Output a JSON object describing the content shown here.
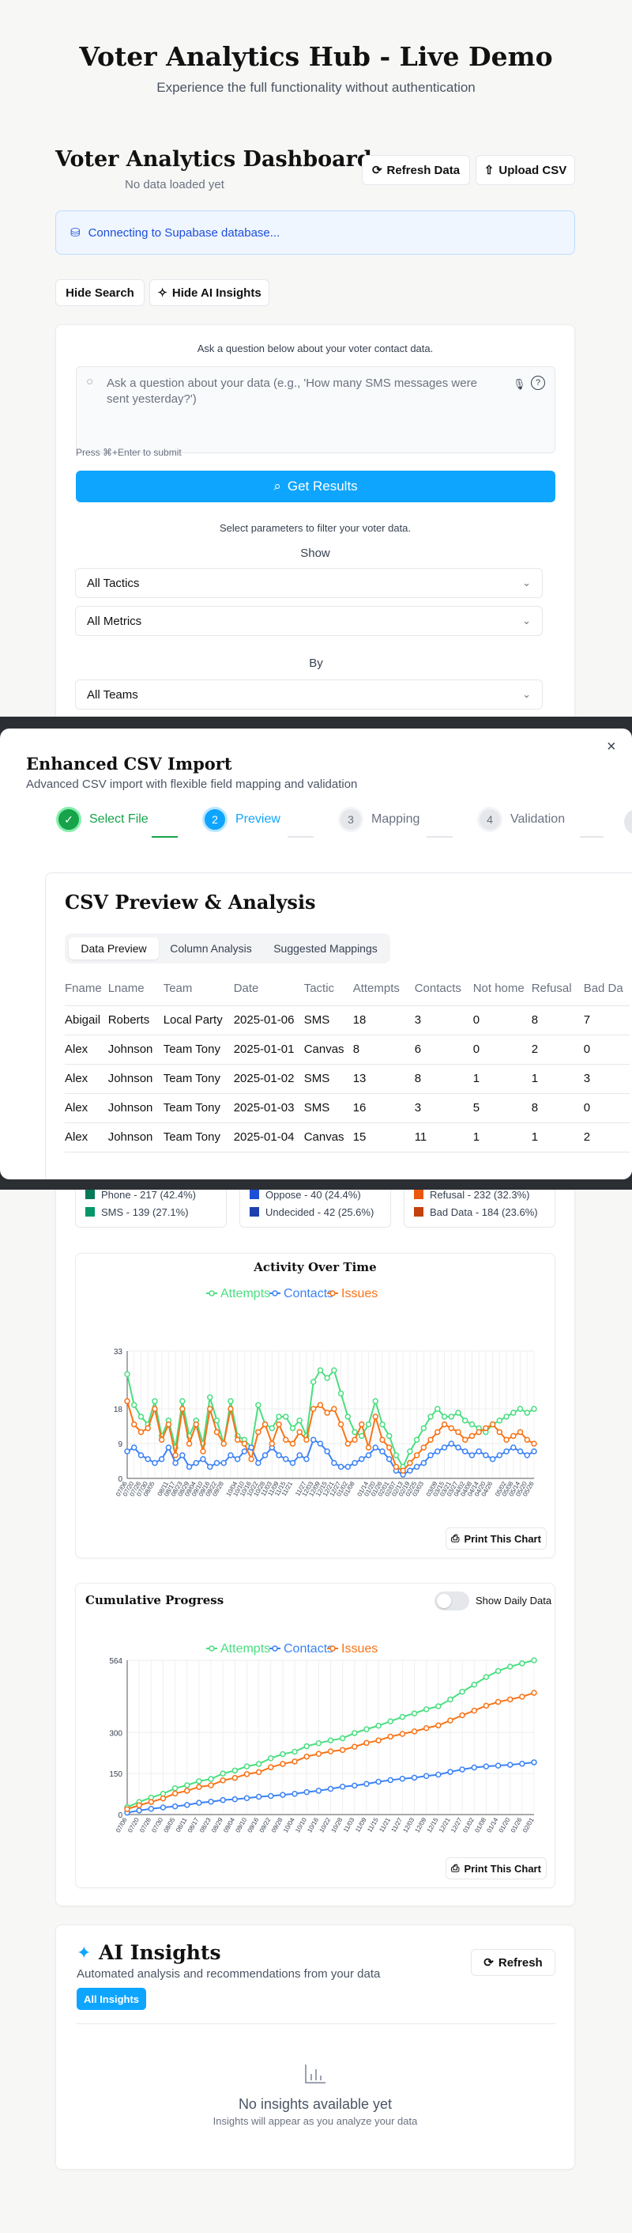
{
  "hero": {
    "title": "Voter Analytics Hub - Live Demo",
    "subtitle": "Experience the full functionality without authentication"
  },
  "dashboard": {
    "title": "Voter Analytics Dashboard",
    "status": "No data loaded yet",
    "refresh_label": "Refresh Data",
    "upload_label": "Upload CSV",
    "db_notice": "Connecting to Supabase database..."
  },
  "toggles": {
    "hide_search": "Hide Search",
    "hide_ai": "Hide AI Insights"
  },
  "query": {
    "intro": "Ask a question below about your voter contact data.",
    "placeholder": "Ask a question about your data (e.g., 'How many SMS messages were sent yesterday?')",
    "hint": "Press ⌘+Enter to submit",
    "submit_label": "Get Results",
    "params_intro": "Select parameters to filter your voter data.",
    "show_label": "Show",
    "tactic_value": "All Tactics",
    "metric_value": "All Metrics",
    "by_label": "By",
    "team_value": "All Teams"
  },
  "modal": {
    "title": "Enhanced CSV Import",
    "subtitle": "Advanced CSV import with flexible field mapping and validation",
    "close": "×",
    "steps": [
      {
        "num": "✓",
        "label": "Select File"
      },
      {
        "num": "2",
        "label": "Preview"
      },
      {
        "num": "3",
        "label": "Mapping"
      },
      {
        "num": "4",
        "label": "Validation"
      }
    ],
    "preview_title": "CSV Preview & Analysis",
    "tabs": [
      "Data Preview",
      "Column Analysis",
      "Suggested Mappings"
    ],
    "columns": [
      "Fname",
      "Lname",
      "Team",
      "Date",
      "Tactic",
      "Attempts",
      "Contacts",
      "Not home",
      "Refusal",
      "Bad Da"
    ],
    "rows": [
      [
        "Abigail",
        "Roberts",
        "Local Party",
        "2025-01-06",
        "SMS",
        "18",
        "3",
        "0",
        "8",
        "7"
      ],
      [
        "Alex",
        "Johnson",
        "Team Tony",
        "2025-01-01",
        "Canvas",
        "8",
        "6",
        "0",
        "2",
        "0"
      ],
      [
        "Alex",
        "Johnson",
        "Team Tony",
        "2025-01-02",
        "SMS",
        "13",
        "8",
        "1",
        "1",
        "3"
      ],
      [
        "Alex",
        "Johnson",
        "Team Tony",
        "2025-01-03",
        "SMS",
        "16",
        "3",
        "5",
        "8",
        "0"
      ],
      [
        "Alex",
        "Johnson",
        "Team Tony",
        "2025-01-04",
        "Canvas",
        "15",
        "11",
        "1",
        "1",
        "2"
      ]
    ]
  },
  "legends": {
    "tactics": [
      {
        "label": "Phone - 217 (42.4%)",
        "color": "#047857"
      },
      {
        "label": "SMS - 139 (27.1%)",
        "color": "#059669"
      }
    ],
    "contacts": [
      {
        "label": "Oppose - 40 (24.4%)",
        "color": "#1d4ed8"
      },
      {
        "label": "Undecided - 42 (25.6%)",
        "color": "#1e40af"
      }
    ],
    "issues": [
      {
        "label": "Refusal - 232 (32.3%)",
        "color": "#ea580c"
      },
      {
        "label": "Bad Data - 184 (23.6%)",
        "color": "#c2410c"
      }
    ]
  },
  "print_label": "Print This Chart",
  "daily_toggle": "Show Daily Data",
  "colors": {
    "attempts": "#4ade80",
    "contacts": "#3b82f6",
    "issues": "#f97316",
    "primary": "#0ea5ff"
  },
  "chart_data": [
    {
      "type": "line",
      "title": "Activity Over Time",
      "x": [
        "07/06",
        "07/14",
        "07/20",
        "07/26",
        "08/01",
        "08/07",
        "08/13",
        "08/19",
        "08/25",
        "08/31",
        "09/06",
        "09/12",
        "09/18",
        "09/24",
        "09/30",
        "10/06",
        "10/12",
        "10/18",
        "10/24",
        "10/30",
        "11/05",
        "11/11",
        "11/17",
        "11/23",
        "11/29",
        "12/05",
        "12/11",
        "12/17",
        "12/23",
        "12/29",
        "01/04",
        "01/10",
        "01/16",
        "01/22",
        "01/28",
        "02/03",
        "02/09",
        "02/15",
        "02/21",
        "02/27",
        "03/05",
        "03/11",
        "03/17",
        "03/23",
        "03/29",
        "04/04",
        "04/10",
        "04/16",
        "04/22",
        "04/28",
        "05/04",
        "05/10",
        "05/16",
        "05/22",
        "05/28",
        "06/03",
        "06/09",
        "06/15",
        "06/21",
        "06/27"
      ],
      "x_ticks": [
        "07/06",
        "07/20",
        "07/26",
        "07/30",
        "08/05",
        "08/11",
        "08/17",
        "08/23",
        "08/29",
        "09/04",
        "09/10",
        "09/16",
        "09/22",
        "09/28",
        "10/04",
        "10/10",
        "10/16",
        "10/22",
        "10/28",
        "11/03",
        "11/09",
        "11/15",
        "11/21",
        "11/27",
        "12/03",
        "12/09",
        "12/15",
        "12/21",
        "12/27",
        "01/02",
        "01/08",
        "01/14",
        "01/20",
        "01/26",
        "02/01",
        "02/07",
        "02/13",
        "02/19",
        "02/25",
        "03/03",
        "03/09",
        "03/15",
        "03/21",
        "03/27",
        "04/02",
        "04/08",
        "04/14",
        "04/20",
        "04/26",
        "05/02",
        "05/08",
        "05/14",
        "05/20",
        "05/26"
      ],
      "yticks": [
        0,
        9,
        18,
        33
      ],
      "ylim": [
        0,
        33
      ],
      "series": [
        {
          "name": "Attempts",
          "values": [
            27,
            19,
            16,
            14,
            20,
            11,
            15,
            8,
            20,
            11,
            15,
            9,
            21,
            15,
            9,
            20,
            11,
            10,
            8,
            19,
            14,
            13,
            16,
            16,
            13,
            15,
            11,
            25,
            28,
            26,
            28,
            22,
            16,
            12,
            11,
            14,
            20,
            14,
            11,
            6,
            3,
            7,
            10,
            13,
            16,
            18,
            16,
            16,
            17,
            15,
            14,
            13,
            12,
            14,
            15,
            16,
            17,
            18,
            17,
            18
          ]
        },
        {
          "name": "Contacts",
          "values": [
            7,
            8,
            6,
            5,
            4,
            5,
            8,
            4,
            6,
            3,
            4,
            5,
            3,
            4,
            4,
            6,
            5,
            7,
            8,
            4,
            6,
            8,
            6,
            5,
            4,
            6,
            5,
            10,
            9,
            7,
            4,
            3,
            3,
            4,
            5,
            6,
            8,
            7,
            5,
            2,
            1,
            2,
            3,
            4,
            6,
            7,
            8,
            9,
            8,
            7,
            6,
            7,
            6,
            5,
            6,
            7,
            8,
            7,
            6,
            7
          ]
        },
        {
          "name": "Issues",
          "values": [
            20,
            14,
            12,
            13,
            18,
            10,
            14,
            6,
            18,
            9,
            14,
            7,
            18,
            12,
            9,
            18,
            10,
            9,
            5,
            12,
            14,
            9,
            14,
            10,
            9,
            12,
            10,
            18,
            19,
            17,
            18,
            14,
            9,
            10,
            14,
            8,
            16,
            10,
            8,
            3,
            2,
            4,
            6,
            8,
            10,
            12,
            14,
            13,
            12,
            10,
            11,
            12,
            13,
            14,
            12,
            10,
            11,
            12,
            10,
            9
          ]
        }
      ]
    },
    {
      "type": "line",
      "title": "Cumulative Progress",
      "yticks": [
        0,
        150,
        300,
        564
      ],
      "ylim": [
        0,
        564
      ],
      "series": [
        {
          "name": "Attempts",
          "values": [
            27,
            46,
            62,
            76,
            96,
            107,
            122,
            130,
            150,
            161,
            176,
            185,
            206,
            221,
            230,
            250,
            261,
            271,
            279,
            298,
            312,
            325,
            341,
            357,
            370,
            385,
            396,
            421,
            449,
            475,
            503,
            525,
            541,
            553,
            564
          ]
        },
        {
          "name": "Contacts",
          "values": [
            7,
            15,
            21,
            26,
            30,
            35,
            43,
            47,
            53,
            56,
            60,
            65,
            68,
            72,
            76,
            82,
            87,
            94,
            102,
            106,
            112,
            120,
            126,
            131,
            135,
            141,
            146,
            156,
            165,
            172,
            176,
            179,
            182,
            186,
            191
          ]
        },
        {
          "name": "Issues",
          "values": [
            20,
            34,
            46,
            59,
            77,
            87,
            101,
            107,
            125,
            134,
            148,
            155,
            173,
            185,
            194,
            212,
            222,
            231,
            236,
            248,
            262,
            271,
            285,
            295,
            304,
            316,
            326,
            344,
            363,
            380,
            398,
            412,
            421,
            431,
            445
          ]
        }
      ]
    }
  ],
  "ai": {
    "title": "AI Insights",
    "subtitle": "Automated analysis and recommendations from your data",
    "refresh": "Refresh",
    "filter": "All Insights",
    "empty_title": "No insights available yet",
    "empty_sub": "Insights will appear as you analyze your data"
  }
}
